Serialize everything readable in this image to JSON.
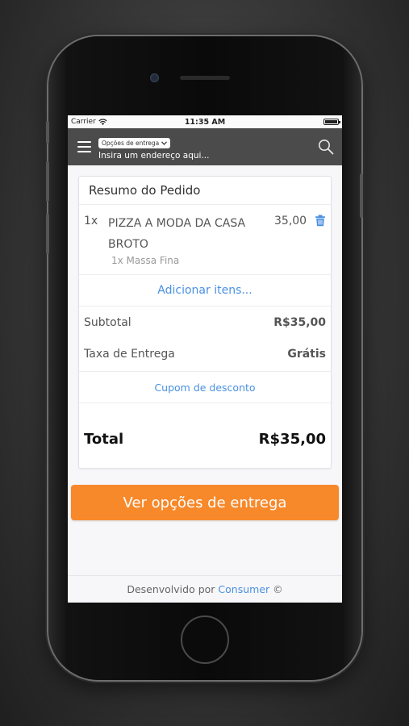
{
  "status_bar": {
    "carrier": "Carrier",
    "time": "11:35 AM",
    "battery_level": 1.0
  },
  "app_bar": {
    "menu_icon": "hamburger-icon",
    "delivery_options_label": "Opções de entrega",
    "address_placeholder": "Insira um endereço aqui...",
    "search_icon": "search-icon"
  },
  "order_summary": {
    "title": "Resumo do Pedido",
    "items": [
      {
        "quantity": "1x",
        "name": "PIZZA A MODA DA CASA BROTO",
        "price": "35,00",
        "option": "1x Massa Fina",
        "delete_icon": "trash-icon"
      }
    ],
    "add_items_label": "Adicionar itens...",
    "subtotal_label": "Subtotal",
    "subtotal_value": "R$35,00",
    "delivery_fee_label": "Taxa de Entrega",
    "delivery_fee_value": "Grátis",
    "coupon_label": "Cupom de desconto",
    "total_label": "Total",
    "total_value": "R$35,00"
  },
  "cta": {
    "label": "Ver opções de entrega"
  },
  "footer": {
    "prefix": "Desenvolvido por",
    "link": "Consumer",
    "suffix": "©"
  },
  "colors": {
    "accent": "#f7892b",
    "link": "#4a90e2",
    "appbar": "#4b4b4b"
  }
}
